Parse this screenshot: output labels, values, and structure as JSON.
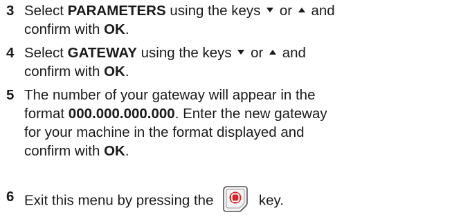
{
  "steps": [
    {
      "number": "3",
      "t1": "Select ",
      "bold": "PARAMETERS",
      "t2": " using the keys",
      "t3": "or",
      "t4": "and",
      "line2a": "confirm with ",
      "line2bold": "OK",
      "line2end": "."
    },
    {
      "number": "4",
      "t1": "Select ",
      "bold": "GATEWAY",
      "t2": " using the keys",
      "t3": "or",
      "t4": "and",
      "line2a": "confirm with ",
      "line2bold": "OK",
      "line2end": "."
    },
    {
      "number": "5",
      "l1": "The number of your gateway will appear in the",
      "l2a": "format ",
      "l2bold": "000.000.000.000",
      "l2b": ". Enter the new gateway",
      "l3": "for your machine in the format displayed and",
      "l4a": "confirm with ",
      "l4bold": "OK",
      "l4end": "."
    },
    {
      "number": "6",
      "t1": "Exit this menu by pressing the",
      "t2": "key."
    }
  ],
  "icons": {
    "down": "arrow-down-icon",
    "up": "arrow-up-icon",
    "stop_key": "stop-key-icon"
  },
  "colors": {
    "stop_key_red": "#d8232a",
    "stop_key_outline": "#555555"
  }
}
